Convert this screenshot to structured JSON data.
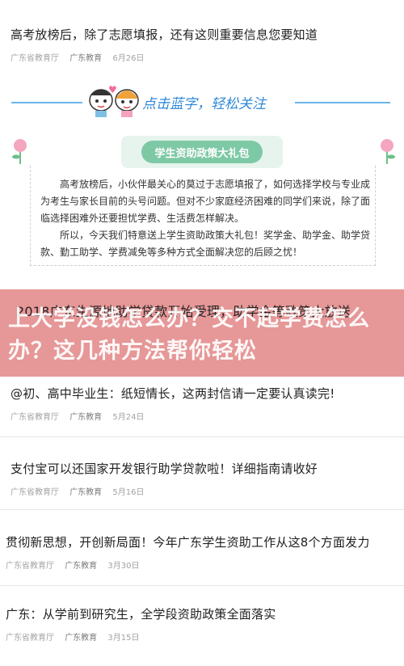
{
  "articles": [
    {
      "title": "高考放榜后，除了志愿填报，还有这则重要信息您要知道",
      "source": "广东省教育厅",
      "author": "广东教育",
      "date": "6月26日"
    },
    {
      "title": "@初、高中毕业生：纸短情长，这两封信请一定要认真读完!",
      "source": "广东省教育厅",
      "author": "广东教育",
      "date": "5月24日"
    },
    {
      "title": "支付宝可以还国家开发银行助学贷款啦！详细指南请收好",
      "source": "广东省教育厅",
      "author": "广东教育",
      "date": "5月16日"
    },
    {
      "title": "贯彻新思想，开创新局面！今年广东学生资助工作从这8个方面发力",
      "source": "广东省教育厅",
      "author": "广东教育",
      "date": "3月30日"
    },
    {
      "title": "广东：从学前到研究生，全学段资助政策全面落实",
      "source": "广东省教育厅",
      "author": "广东教育",
      "date": "3月15日"
    }
  ],
  "banner": {
    "follow_text": "点击蓝字，轻松关注",
    "badge_text": "学生资助政策大礼包",
    "intro_p1": "高考放榜后，小伙伴最关心的莫过于志愿填报了，如何选择学校与专业成为考生与家长目前的头号问题。但对不少家庭经济困难的同学们来说，除了面临选择困难外还要担忧学费、生活费怎样解决。",
    "intro_p2": "所以，今天我们特意送上学生资助政策大礼包！奖学金、助学金、助学贷款、勤工助学、学费减免等多种方式全面解决您的后顾之忧！"
  },
  "overlay": {
    "row1": "2018广东生源地助学贷款开始受理，助学金等政策大放送",
    "big1": "上大学没钱怎么办？交不起学费怎么",
    "big2": "办？这几种方法帮你轻松"
  },
  "colors": {
    "accent": "#2f88d7",
    "overlay": "#e18080",
    "badge": "#7ec9a5"
  }
}
